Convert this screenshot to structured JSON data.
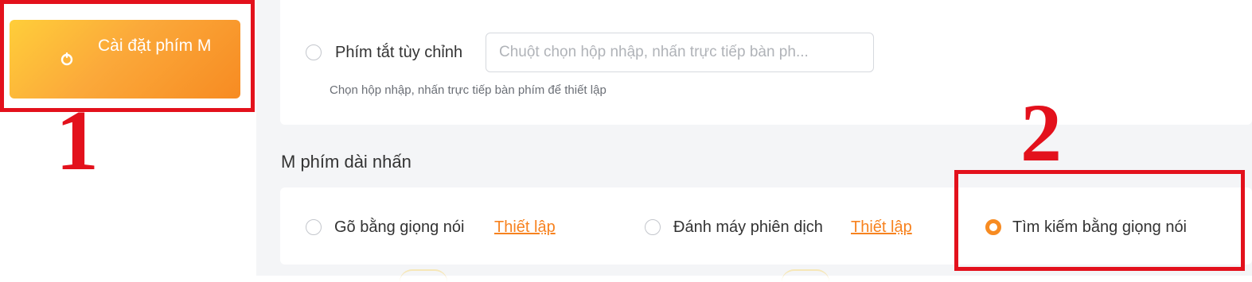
{
  "sidebar": {
    "m_key_button_label": "Cài đặt phím M",
    "annotation_number": "1"
  },
  "shortcut": {
    "option_label": "Phím tắt tùy chỉnh",
    "input_placeholder": "Chuột chọn hộp nhập, nhấn trực tiếp bàn ph...",
    "hint": "Chọn hộp nhập, nhấn trực tiếp bàn phím để thiết lập"
  },
  "long_press": {
    "section_title": "M phím dài nhấn",
    "options": [
      {
        "label": "Gõ bằng giọng nói",
        "link": "Thiết lập",
        "checked": false
      },
      {
        "label": "Đánh máy phiên dịch",
        "link": "Thiết lập",
        "checked": false
      },
      {
        "label": "Tìm kiếm bằng giọng nói",
        "checked": true
      }
    ],
    "annotation_number": "2"
  },
  "colors": {
    "accent": "#f78b22",
    "annotation_red": "#e3111c",
    "link": "#f7821f"
  },
  "icons": {
    "m_button_icon": "mic-icon"
  }
}
